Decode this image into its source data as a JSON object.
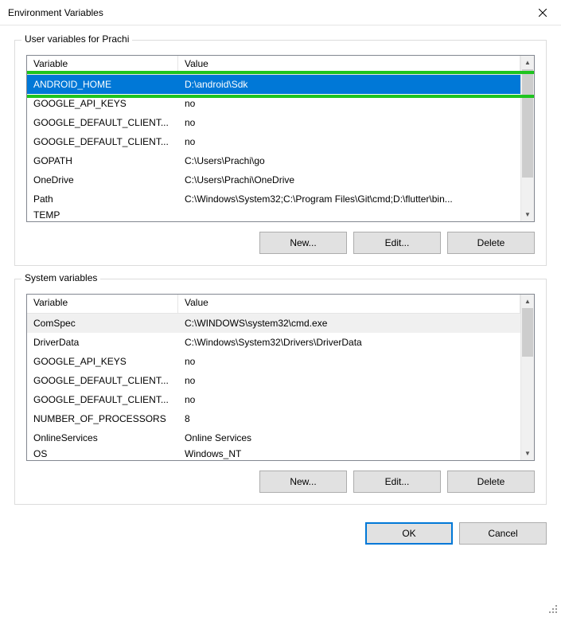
{
  "window": {
    "title": "Environment Variables"
  },
  "user_section": {
    "label": "User variables for Prachi",
    "columns": {
      "variable": "Variable",
      "value": "Value"
    },
    "rows": [
      {
        "variable": "ANDROID_HOME",
        "value": "D:\\android\\Sdk",
        "selected": true
      },
      {
        "variable": "GOOGLE_API_KEYS",
        "value": "no"
      },
      {
        "variable": "GOOGLE_DEFAULT_CLIENT...",
        "value": "no"
      },
      {
        "variable": "GOOGLE_DEFAULT_CLIENT...",
        "value": "no"
      },
      {
        "variable": "GOPATH",
        "value": "C:\\Users\\Prachi\\go"
      },
      {
        "variable": "OneDrive",
        "value": "C:\\Users\\Prachi\\OneDrive"
      },
      {
        "variable": "Path",
        "value": "C:\\Windows\\System32;C:\\Program Files\\Git\\cmd;D:\\flutter\\bin..."
      },
      {
        "variable": "TEMP",
        "value": ""
      }
    ],
    "buttons": {
      "new": "New...",
      "edit": "Edit...",
      "delete": "Delete"
    }
  },
  "system_section": {
    "label": "System variables",
    "columns": {
      "variable": "Variable",
      "value": "Value"
    },
    "rows": [
      {
        "variable": "ComSpec",
        "value": "C:\\WINDOWS\\system32\\cmd.exe",
        "selected": true
      },
      {
        "variable": "DriverData",
        "value": "C:\\Windows\\System32\\Drivers\\DriverData"
      },
      {
        "variable": "GOOGLE_API_KEYS",
        "value": "no"
      },
      {
        "variable": "GOOGLE_DEFAULT_CLIENT...",
        "value": "no"
      },
      {
        "variable": "GOOGLE_DEFAULT_CLIENT...",
        "value": "no"
      },
      {
        "variable": "NUMBER_OF_PROCESSORS",
        "value": "8"
      },
      {
        "variable": "OnlineServices",
        "value": "Online Services"
      },
      {
        "variable": "OS",
        "value": "Windows_NT"
      }
    ],
    "buttons": {
      "new": "New...",
      "edit": "Edit...",
      "delete": "Delete"
    }
  },
  "footer": {
    "ok": "OK",
    "cancel": "Cancel"
  }
}
